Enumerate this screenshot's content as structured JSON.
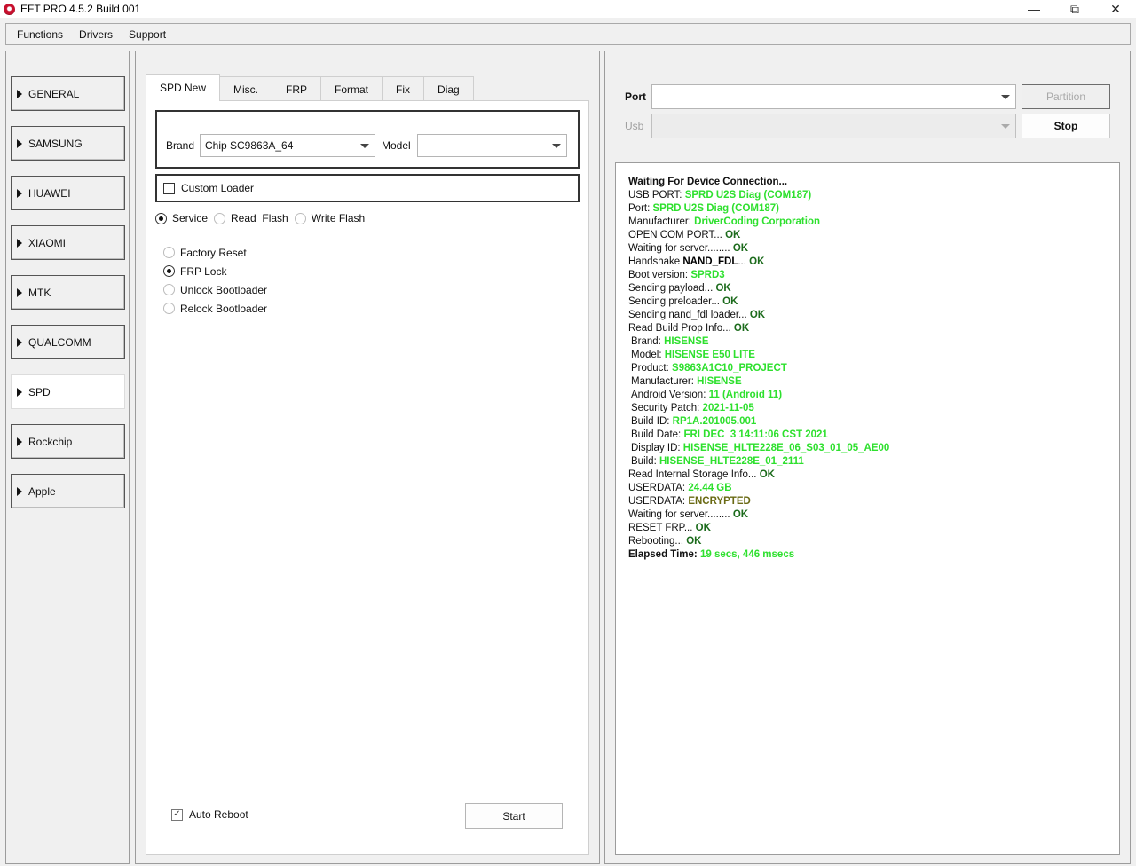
{
  "window": {
    "title": "EFT PRO 4.5.2 Build 001"
  },
  "menu": [
    "Functions",
    "Drivers",
    "Support"
  ],
  "sidebar": {
    "items": [
      {
        "label": "GENERAL",
        "active": false
      },
      {
        "label": "SAMSUNG",
        "active": false
      },
      {
        "label": "HUAWEI",
        "active": false
      },
      {
        "label": "XIAOMI",
        "active": false
      },
      {
        "label": "MTK",
        "active": false
      },
      {
        "label": "QUALCOMM",
        "active": false
      },
      {
        "label": "SPD",
        "active": true
      },
      {
        "label": "Rockchip",
        "active": false
      },
      {
        "label": "Apple",
        "active": false
      }
    ]
  },
  "tabs": [
    {
      "label": "SPD New",
      "active": true
    },
    {
      "label": "Misc.",
      "active": false
    },
    {
      "label": "FRP",
      "active": false
    },
    {
      "label": "Format",
      "active": false
    },
    {
      "label": "Fix",
      "active": false
    },
    {
      "label": "Diag",
      "active": false
    }
  ],
  "spd": {
    "brand_label": "Brand",
    "brand_value": "Chip SC9863A_64",
    "model_label": "Model",
    "model_value": "",
    "custom_loader_label": "Custom Loader",
    "custom_loader_checked": false,
    "modes": [
      {
        "label": "Service",
        "selected": true
      },
      {
        "label": "Read  Flash",
        "selected": false
      },
      {
        "label": "Write Flash",
        "selected": false
      }
    ],
    "operations": [
      {
        "label": "Factory Reset",
        "selected": false
      },
      {
        "label": "FRP Lock",
        "selected": true
      },
      {
        "label": "Unlock Bootloader",
        "selected": false
      },
      {
        "label": "Relock Bootloader",
        "selected": false
      }
    ],
    "auto_reboot_label": "Auto Reboot",
    "auto_reboot_checked": true,
    "start_label": "Start"
  },
  "connection": {
    "port_label": "Port",
    "port_value": "",
    "usb_label": "Usb",
    "usb_value": "",
    "partition_label": "Partition",
    "stop_label": "Stop"
  },
  "log": [
    {
      "label": "Waiting For Device Connection...",
      "value": "",
      "style": "",
      "bold": true
    },
    {
      "label": "USB PORT: ",
      "value": "SPRD U2S Diag (COM187)",
      "style": "green"
    },
    {
      "label": "Port: ",
      "value": "SPRD U2S Diag (COM187)",
      "style": "green"
    },
    {
      "label": "Manufacturer: ",
      "value": "DriverCoding Corporation",
      "style": "green"
    },
    {
      "label": "OPEN COM PORT... ",
      "value": "OK",
      "style": "ok"
    },
    {
      "label": "Waiting for server........ ",
      "value": "OK",
      "style": "ok"
    },
    {
      "label": "Handshake ",
      "value": "NAND_FDL",
      "style": "dark",
      "suffix": "... ",
      "suffix_value": "OK"
    },
    {
      "label": "Boot version: ",
      "value": "SPRD3",
      "style": "green"
    },
    {
      "label": "Sending payload... ",
      "value": "OK",
      "style": "ok"
    },
    {
      "label": "Sending preloader... ",
      "value": "OK",
      "style": "ok"
    },
    {
      "label": "Sending nand_fdl loader... ",
      "value": "OK",
      "style": "ok"
    },
    {
      "label": "Read Build Prop Info... ",
      "value": "OK",
      "style": "ok"
    },
    {
      "label": "Brand: ",
      "value": "HISENSE",
      "style": "green",
      "indent": true
    },
    {
      "label": "Model: ",
      "value": "HISENSE E50 LITE",
      "style": "green",
      "indent": true
    },
    {
      "label": "Product: ",
      "value": "S9863A1C10_PROJECT",
      "style": "green",
      "indent": true
    },
    {
      "label": "Manufacturer: ",
      "value": "HISENSE",
      "style": "green",
      "indent": true
    },
    {
      "label": "Android Version: ",
      "value": "11 (Android 11)",
      "style": "green",
      "indent": true
    },
    {
      "label": "Security Patch: ",
      "value": "2021-11-05",
      "style": "green",
      "indent": true
    },
    {
      "label": "Build ID: ",
      "value": "RP1A.201005.001",
      "style": "green",
      "indent": true
    },
    {
      "label": "Build Date: ",
      "value": "FRI DEC  3 14:11:06 CST 2021",
      "style": "green",
      "indent": true
    },
    {
      "label": "Display ID: ",
      "value": "HISENSE_HLTE228E_06_S03_01_05_AE00",
      "style": "green",
      "indent": true
    },
    {
      "label": "Build: ",
      "value": "HISENSE_HLTE228E_01_2111",
      "style": "green",
      "indent": true
    },
    {
      "label": "Read Internal Storage Info... ",
      "value": "OK",
      "style": "ok"
    },
    {
      "label": "USERDATA: ",
      "value": "24.44 GB",
      "style": "green"
    },
    {
      "label": "USERDATA: ",
      "value": "ENCRYPTED",
      "style": "olive"
    },
    {
      "label": "Waiting for server........ ",
      "value": "OK",
      "style": "ok"
    },
    {
      "label": "RESET FRP... ",
      "value": "OK",
      "style": "ok"
    },
    {
      "label": "Rebooting... ",
      "value": "OK",
      "style": "ok"
    },
    {
      "label": "Elapsed Time: ",
      "value": "19 secs, 446 msecs",
      "style": "green",
      "bold": true
    }
  ]
}
